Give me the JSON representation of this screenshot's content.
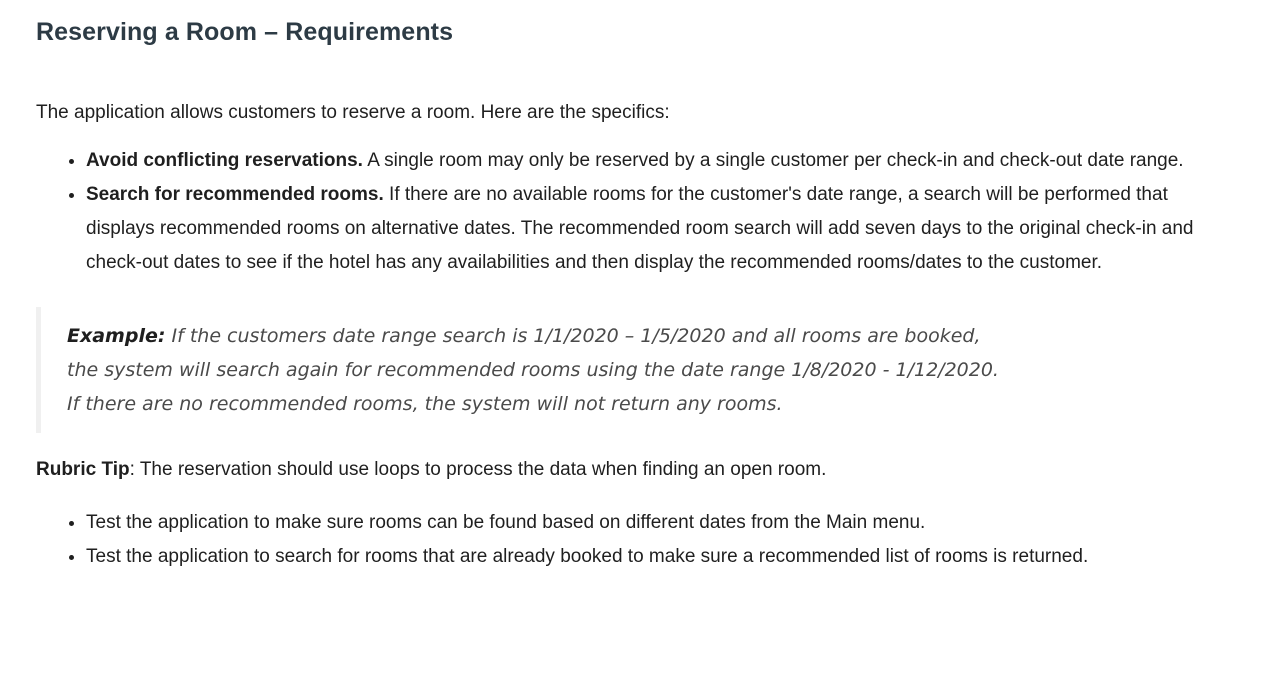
{
  "heading": "Reserving a Room – Requirements",
  "intro": "The application allows customers to reserve a room. Here are the specifics:",
  "requirements": [
    {
      "label": "Avoid conflicting reservations.",
      "text": " A single room may only be reserved by a single customer per check-in and check-out date range."
    },
    {
      "label": "Search for recommended rooms.",
      "text": " If there are no available rooms for the customer's date range, a search will be performed that displays recommended rooms on alternative dates. The recommended room search will add seven days to the original check-in and check-out dates to see if the hotel has any availabilities and then display the recommended rooms/dates to the customer."
    }
  ],
  "example": {
    "label": "Example:",
    "text": " If the customers date range search is 1/1/2020 – 1/5/2020 and all rooms are booked, the system will search again for recommended rooms using the date range 1/8/2020 - 1/12/2020. If there are no recommended rooms, the system will not return any rooms."
  },
  "rubric": {
    "label": "Rubric Tip",
    "text": ": The reservation should use loops to process the data when finding an open room."
  },
  "tests": [
    "Test the application to make sure rooms can be found based on different dates from the Main menu.",
    "Test the application to search for rooms that are already booked to make sure a recommended list of rooms is returned."
  ]
}
